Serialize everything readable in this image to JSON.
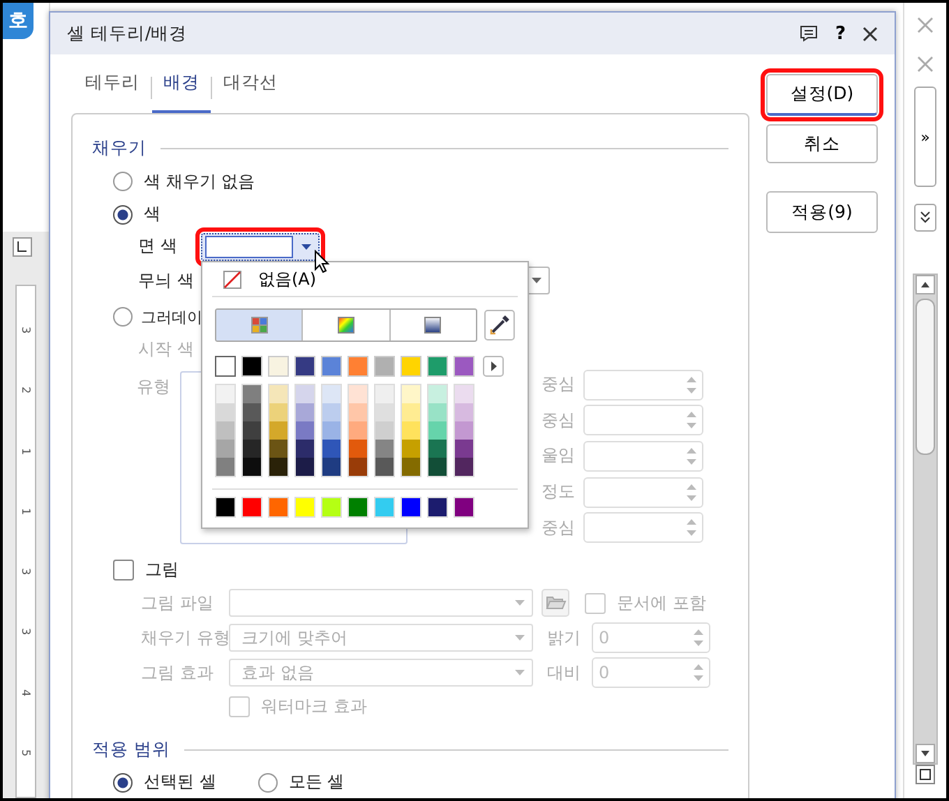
{
  "app": {
    "logo": "호",
    "expand_button": "»",
    "ruler_labels": [
      "3",
      "2",
      "1",
      "1",
      "3",
      "3",
      "4",
      "5"
    ]
  },
  "dialog": {
    "title": "셀 테두리/배경",
    "help": "?",
    "tabs": [
      {
        "label": "테두리",
        "selected": false
      },
      {
        "label": "배경",
        "selected": true
      },
      {
        "label": "대각선",
        "selected": false
      }
    ],
    "buttons": [
      {
        "label": "설정(D)",
        "highlighted": true
      },
      {
        "label": "취소",
        "highlighted": false
      },
      {
        "label": "적용(9)",
        "highlighted": false
      }
    ]
  },
  "fill": {
    "heading": "채우기",
    "options": [
      {
        "label": "색 채우기 없음",
        "selected": false
      },
      {
        "label": "색",
        "selected": true
      }
    ],
    "face_color": {
      "label": "면 색",
      "highlighted": true
    },
    "pattern_color": {
      "label": "무늬 색"
    },
    "gradient": {
      "label": "그러데이",
      "selected": false,
      "start_label": "시작 색",
      "type_label": "유형",
      "right_labels": [
        "중심",
        "중심",
        "울임",
        "정도",
        "중심"
      ]
    }
  },
  "color_popup": {
    "none_label": "없음(A)",
    "modes": [
      {
        "kind": "palette",
        "selected": true
      },
      {
        "kind": "spectrum",
        "selected": false
      },
      {
        "kind": "gradient",
        "selected": false
      }
    ],
    "base_colors": [
      {
        "color": "#ffffff",
        "selected": true
      },
      {
        "color": "#000000",
        "selected": false
      },
      {
        "color": "#f8f3e1",
        "selected": false
      },
      {
        "color": "#353a83",
        "selected": false
      },
      {
        "color": "#5b83d8",
        "selected": false
      },
      {
        "color": "#ff8033",
        "selected": false
      },
      {
        "color": "#b0b0b0",
        "selected": false
      },
      {
        "color": "#ffd400",
        "selected": false
      },
      {
        "color": "#1e9c6a",
        "selected": false
      },
      {
        "color": "#9b59c0",
        "selected": false
      }
    ],
    "shade_columns": [
      {
        "shades": [
          {
            "color": "#f2f2f2"
          },
          {
            "color": "#d9d9d9"
          },
          {
            "color": "#bfbfbf"
          },
          {
            "color": "#a6a6a6"
          },
          {
            "color": "#808080"
          }
        ]
      },
      {
        "shades": [
          {
            "color": "#7f7f7f"
          },
          {
            "color": "#595959"
          },
          {
            "color": "#3f3f3f"
          },
          {
            "color": "#262626"
          },
          {
            "color": "#0d0d0d"
          }
        ]
      },
      {
        "shades": [
          {
            "color": "#f5e6b8"
          },
          {
            "color": "#ecd27a"
          },
          {
            "color": "#d4a82a"
          },
          {
            "color": "#6b5414"
          },
          {
            "color": "#2a2208"
          }
        ]
      },
      {
        "shades": [
          {
            "color": "#d5d5ec"
          },
          {
            "color": "#a8a8d8"
          },
          {
            "color": "#7a7ac4"
          },
          {
            "color": "#2c2c6a"
          },
          {
            "color": "#1c1c48"
          }
        ]
      },
      {
        "shades": [
          {
            "color": "#dde6f6"
          },
          {
            "color": "#bccdee"
          },
          {
            "color": "#9ab3e6"
          },
          {
            "color": "#2f56b8"
          },
          {
            "color": "#1f3c82"
          }
        ]
      },
      {
        "shades": [
          {
            "color": "#ffe2d4"
          },
          {
            "color": "#ffc6a8"
          },
          {
            "color": "#ffaa7e"
          },
          {
            "color": "#e25a0c"
          },
          {
            "color": "#993c08"
          }
        ]
      },
      {
        "shades": [
          {
            "color": "#efefef"
          },
          {
            "color": "#dfdfdf"
          },
          {
            "color": "#cfcfcf"
          },
          {
            "color": "#858585"
          },
          {
            "color": "#595959"
          }
        ]
      },
      {
        "shades": [
          {
            "color": "#fff6c8"
          },
          {
            "color": "#ffec92"
          },
          {
            "color": "#ffe25c"
          },
          {
            "color": "#c6a000"
          },
          {
            "color": "#846b00"
          }
        ]
      },
      {
        "shades": [
          {
            "color": "#c8f0e0"
          },
          {
            "color": "#98e2c6"
          },
          {
            "color": "#66d4ab"
          },
          {
            "color": "#1a7552"
          },
          {
            "color": "#124e37"
          }
        ]
      },
      {
        "shades": [
          {
            "color": "#ebdcef"
          },
          {
            "color": "#d7bae0"
          },
          {
            "color": "#c398d1"
          },
          {
            "color": "#7a3a90"
          },
          {
            "color": "#52265f"
          }
        ]
      }
    ],
    "standard_colors": [
      {
        "color": "#000000"
      },
      {
        "color": "#ff0000"
      },
      {
        "color": "#ff6600"
      },
      {
        "color": "#ffff00"
      },
      {
        "color": "#b5ff14"
      },
      {
        "color": "#008000"
      },
      {
        "color": "#33ccf0"
      },
      {
        "color": "#0000ff"
      },
      {
        "color": "#1c1c6e"
      },
      {
        "color": "#800080"
      }
    ]
  },
  "picture": {
    "label": "그림",
    "checked": false,
    "file_label": "그림 파일",
    "include_label": "문서에 포함",
    "include_checked": false,
    "fill_type_label": "채우기 유형",
    "fill_type_value": "크기에 맞추어",
    "brightness_label": "밝기",
    "brightness_value": "0",
    "effect_label": "그림 효과",
    "effect_value": "효과 없음",
    "contrast_label": "대비",
    "contrast_value": "0",
    "watermark_label": "워터마크 효과",
    "watermark_checked": false
  },
  "scope": {
    "heading": "적용 범위",
    "options": [
      {
        "label": "선택된 셀",
        "selected": true
      },
      {
        "label": "모든 셀",
        "selected": false
      }
    ]
  }
}
